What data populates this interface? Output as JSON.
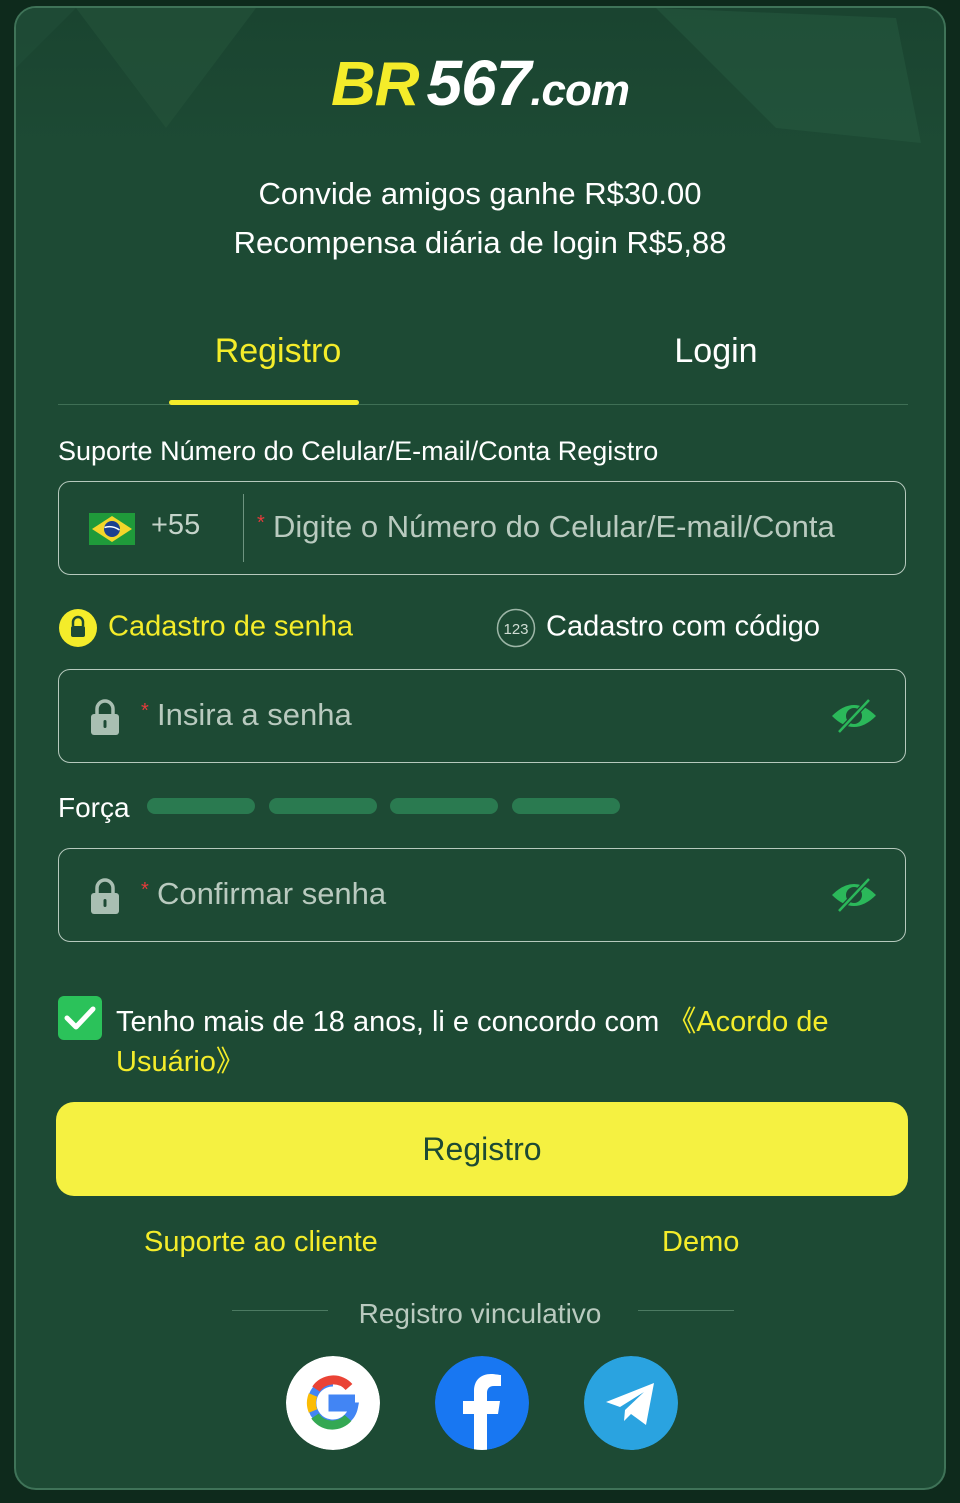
{
  "brand": {
    "logo_br": "BR",
    "logo_num": "567",
    "logo_domain": ".com"
  },
  "promo": {
    "line1": "Convide amigos ganhe R$30.00",
    "line2": "Recompensa diária de login R$5,88"
  },
  "tabs": [
    {
      "label": "Registro",
      "active": true
    },
    {
      "label": "Login",
      "active": false
    }
  ],
  "form": {
    "support_label": "Suporte Número do Celular/E-mail/Conta Registro",
    "country_code": "+55",
    "account_placeholder": "Digite o Número do Celular/E-mail/Conta",
    "required_mark": "*",
    "option_password": "Cadastro de senha",
    "option_code": "Cadastro com código",
    "option_code_badge": "123",
    "password_placeholder": "Insira a senha",
    "strength_label": "Força",
    "strength_level": 0,
    "confirm_placeholder": "Confirmar senha",
    "terms_text": "Tenho mais de 18 anos, li e concordo com ",
    "terms_link": "《Acordo de Usuário》",
    "terms_checked": true,
    "submit_label": "Registro"
  },
  "footer": {
    "support_link": "Suporte ao cliente",
    "demo_link": "Demo",
    "binding_label": "Registro vinculativo"
  },
  "social": [
    "google-icon",
    "facebook-icon",
    "telegram-icon"
  ],
  "colors": {
    "accent_yellow": "#f4ec2a",
    "card_green": "#1d4a34",
    "button_yellow": "#f5f141",
    "check_green": "#2bc25a"
  }
}
